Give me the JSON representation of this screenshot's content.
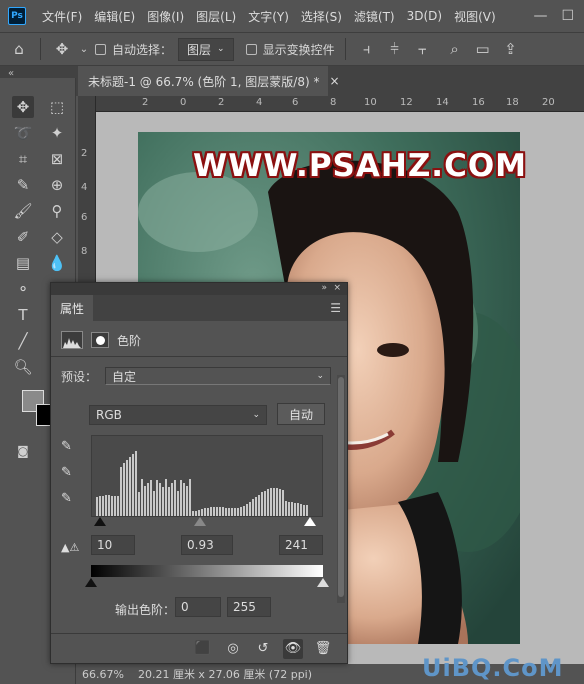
{
  "app": {
    "logo": "Ps"
  },
  "menu": [
    "文件(F)",
    "编辑(E)",
    "图像(I)",
    "图层(L)",
    "文字(Y)",
    "选择(S)",
    "滤镜(T)",
    "3D(D)",
    "视图(V)"
  ],
  "options_bar": {
    "auto_select_label": "自动选择：",
    "auto_select_value": "图层",
    "show_transform_label": "显示变换控件"
  },
  "document": {
    "tab_title": "未标题-1 @ 66.7% (色阶 1, 图层蒙版/8) *",
    "close": "×"
  },
  "rulers": {
    "top": [
      "2",
      "0",
      "2",
      "4",
      "6",
      "8",
      "10",
      "12",
      "14",
      "16",
      "18",
      "20",
      "22"
    ],
    "left": [
      "2",
      "4",
      "6",
      "8",
      "0",
      "2",
      "4",
      "6",
      "8"
    ]
  },
  "image": {
    "watermark": "WWW.PSAHZ.COM"
  },
  "status": {
    "zoom": "66.67%",
    "size": "20.21 厘米 x 27.06 厘米 (72 ppi)"
  },
  "footer_brand": "UiBQ.CoM",
  "properties_panel": {
    "tab": "属性",
    "adjustment_name": "色阶",
    "preset_label": "预设：",
    "preset_value": "自定",
    "channel": "RGB",
    "auto_button": "自动",
    "input_black": "10",
    "input_gamma": "0.93",
    "input_white": "241",
    "input_black_fraction": 0.039,
    "input_gamma_fraction": 0.47,
    "input_white_fraction": 0.945,
    "output_label": "输出色阶：",
    "output_black": "0",
    "output_white": "255"
  },
  "colors": {
    "foreground": "#8a8a8a",
    "background": "#000000",
    "watermark_stroke": "#8b1010",
    "brand": "#5f95c8"
  }
}
